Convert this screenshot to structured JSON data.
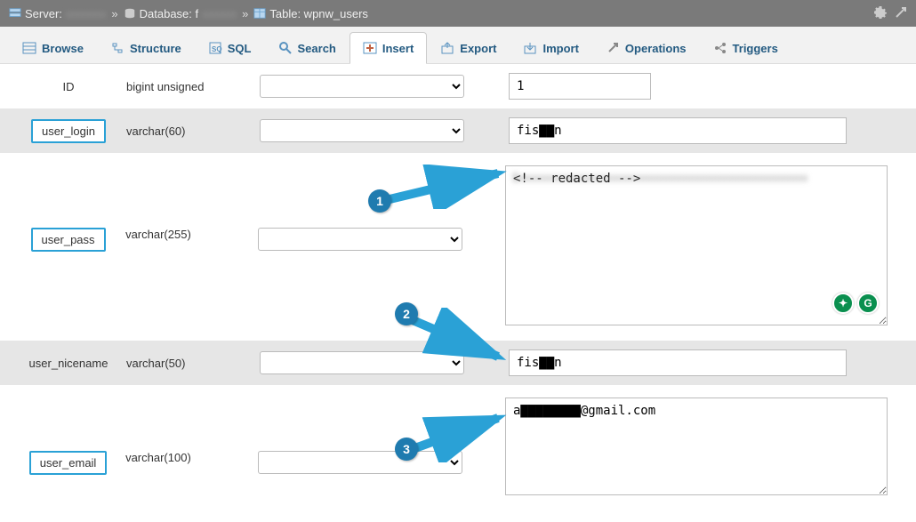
{
  "breadcrumb": {
    "server_label": "Server:",
    "server_value": "",
    "db_label": "Database: f",
    "table_label": "Table: wpnw_users"
  },
  "tabs": {
    "browse": "Browse",
    "structure": "Structure",
    "sql": "SQL",
    "search": "Search",
    "insert": "Insert",
    "export": "Export",
    "import": "Import",
    "operations": "Operations",
    "triggers": "Triggers"
  },
  "rows": [
    {
      "label": "ID",
      "type": "bigint unsigned",
      "value": "1",
      "highlighted": false,
      "input": "short"
    },
    {
      "label": "user_login",
      "type": "varchar(60)",
      "value": "fis▇▇n",
      "highlighted": true,
      "input": "text"
    },
    {
      "label": "user_pass",
      "type": "varchar(255)",
      "value": "",
      "highlighted": true,
      "input": "big_textarea"
    },
    {
      "label": "user_nicename",
      "type": "varchar(50)",
      "value": "fis▇▇n",
      "highlighted": false,
      "input": "text"
    },
    {
      "label": "user_email",
      "type": "varchar(100)",
      "value": "a▇▇▇▇▇▇▇▇@gmail.com",
      "highlighted": true,
      "input": "med_textarea"
    }
  ],
  "callouts": {
    "one": "1",
    "two": "2",
    "three": "3"
  }
}
